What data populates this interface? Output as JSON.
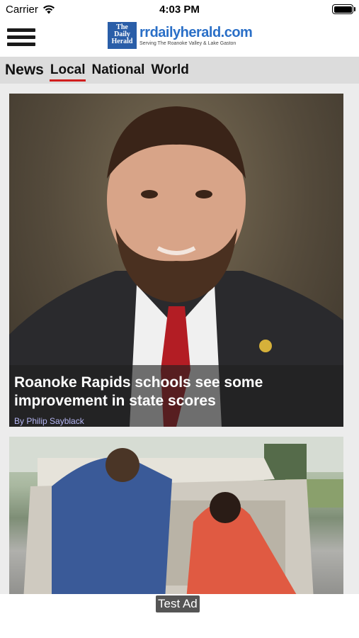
{
  "status_bar": {
    "carrier": "Carrier",
    "time": "4:03 PM",
    "wifi_icon": "wifi-icon",
    "battery_icon": "battery-icon"
  },
  "header": {
    "menu_icon": "hamburger-menu-icon",
    "logo_box_line1": "The",
    "logo_box_line2": "Daily",
    "logo_box_line3": "Herald",
    "logo_domain": "rrdailyherald.com",
    "logo_tagline": "Serving The Roanoke Valley & Lake Gaston"
  },
  "tabs": [
    {
      "label": "News"
    },
    {
      "label": "Local",
      "active": true
    },
    {
      "label": "National"
    },
    {
      "label": "World"
    }
  ],
  "articles": [
    {
      "headline": "Roanoke Rapids schools see some improvement in state scores",
      "byline": "By Philip Sayblack"
    },
    {
      "headline": "",
      "byline": ""
    }
  ],
  "ad": {
    "label": "Test Ad"
  },
  "colors": {
    "active_tab_underline": "#d11f1f",
    "byline": "#b5b6f3",
    "tab_bar_bg": "#dcdcdc",
    "logo_blue": "#2a6fc7"
  }
}
